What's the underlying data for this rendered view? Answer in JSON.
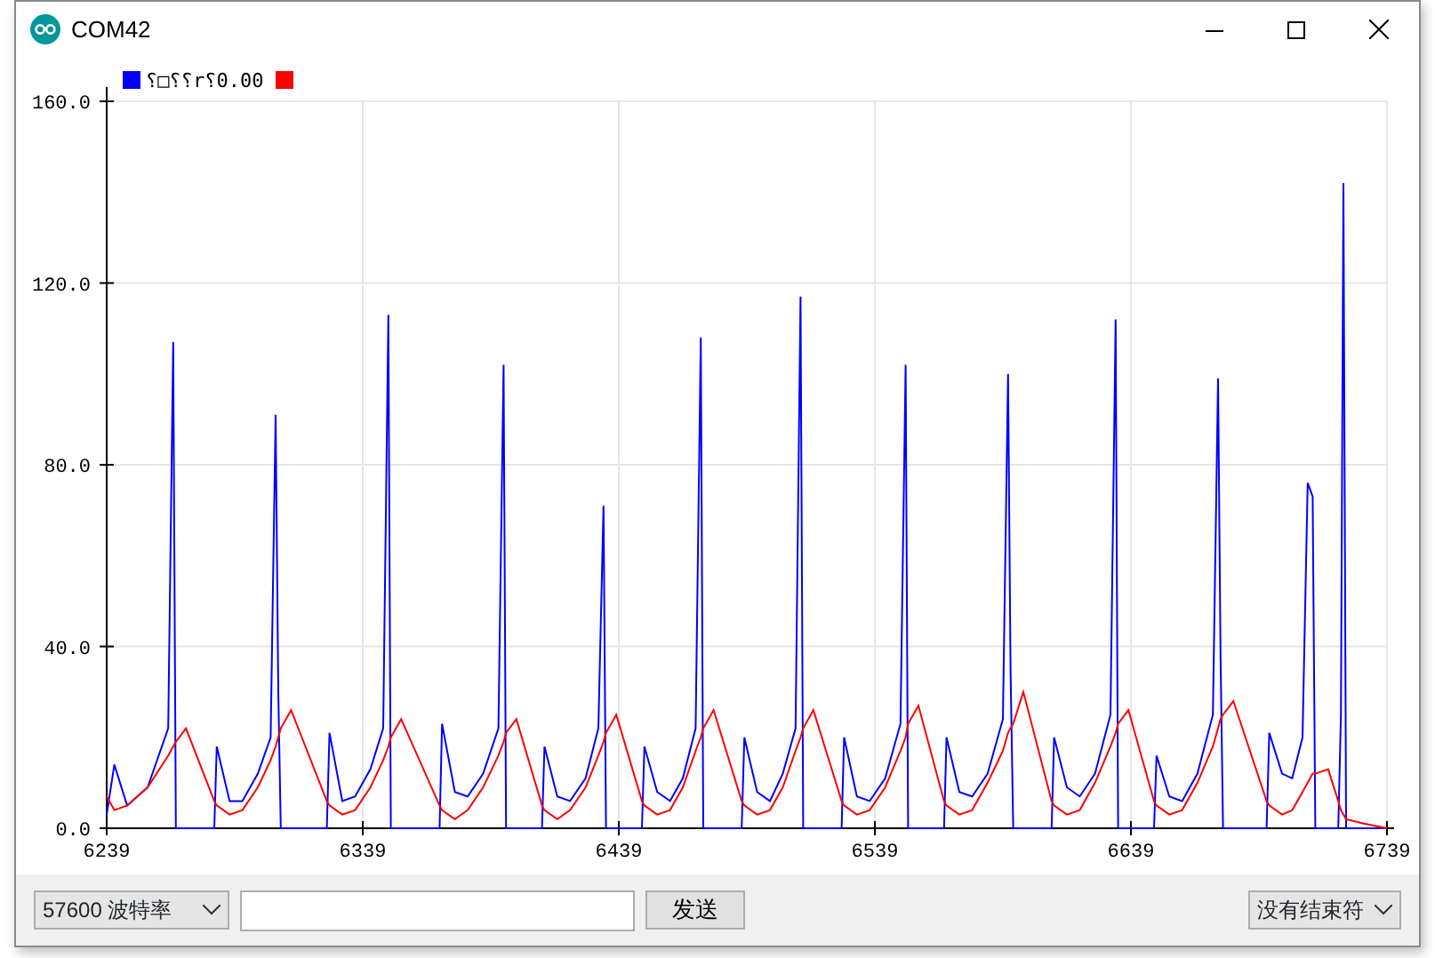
{
  "window": {
    "title": "COM42"
  },
  "plot": {
    "chart_data": {
      "type": "line",
      "x": [
        6239,
        6242,
        6247,
        6255,
        6263,
        6265,
        6266,
        6270,
        6281,
        6282,
        6287,
        6292,
        6298,
        6303,
        6305,
        6306,
        6307,
        6311,
        6325,
        6326,
        6331,
        6336,
        6342,
        6347,
        6349,
        6350,
        6354,
        6369,
        6370,
        6375,
        6380,
        6386,
        6392,
        6394,
        6395,
        6399,
        6409,
        6410,
        6415,
        6420,
        6426,
        6431,
        6433,
        6434,
        6438,
        6448,
        6449,
        6454,
        6459,
        6464,
        6469,
        6471,
        6472,
        6476,
        6487,
        6488,
        6493,
        6498,
        6503,
        6508,
        6510,
        6511,
        6515,
        6526,
        6527,
        6532,
        6537,
        6543,
        6549,
        6551,
        6552,
        6556,
        6566,
        6567,
        6572,
        6577,
        6583,
        6589,
        6591,
        6592,
        6593,
        6597,
        6608,
        6609,
        6614,
        6619,
        6625,
        6631,
        6633,
        6634,
        6638,
        6648,
        6649,
        6654,
        6659,
        6665,
        6671,
        6673,
        6674,
        6675,
        6679,
        6692,
        6693,
        6698,
        6702,
        6706,
        6708,
        6710,
        6711,
        6716,
        6720,
        6721,
        6722,
        6723,
        6730,
        6739
      ],
      "series": [
        {
          "name": "⸮□⸮⸮r⸮0.00",
          "color": "#0000ff",
          "values": [
            3,
            14,
            5,
            9,
            22,
            107,
            0,
            0,
            0,
            18,
            6,
            6,
            12,
            20,
            91,
            30,
            0,
            0,
            0,
            21,
            6,
            7,
            13,
            22,
            113,
            0,
            0,
            0,
            23,
            8,
            7,
            12,
            22,
            102,
            0,
            0,
            0,
            18,
            7,
            6,
            11,
            22,
            71,
            0,
            0,
            0,
            18,
            8,
            6,
            11,
            22,
            108,
            0,
            0,
            0,
            20,
            8,
            6,
            12,
            22,
            117,
            0,
            0,
            0,
            20,
            7,
            6,
            11,
            23,
            102,
            0,
            0,
            0,
            20,
            8,
            7,
            12,
            24,
            100,
            35,
            0,
            0,
            0,
            20,
            9,
            7,
            12,
            25,
            112,
            0,
            0,
            0,
            16,
            7,
            6,
            12,
            25,
            99,
            38,
            0,
            0,
            0,
            21,
            12,
            11,
            20,
            76,
            73,
            0,
            0,
            0,
            25,
            142,
            0,
            0,
            0
          ]
        },
        {
          "color": "#ff0000",
          "values": [
            7,
            4,
            5,
            9,
            16,
            18,
            19,
            22,
            6,
            5,
            3,
            4,
            9,
            15,
            18,
            20,
            22,
            26,
            6,
            5,
            3,
            4,
            9,
            15,
            18,
            20,
            24,
            5,
            4,
            2,
            4,
            9,
            16,
            19,
            21,
            24,
            5,
            4,
            2,
            4,
            9,
            16,
            19,
            21,
            25,
            6,
            5,
            3,
            4,
            9,
            17,
            20,
            22,
            26,
            6,
            5,
            3,
            4,
            9,
            17,
            20,
            22,
            26,
            6,
            5,
            3,
            4,
            9,
            17,
            20,
            23,
            27,
            6,
            5,
            3,
            4,
            10,
            17,
            21,
            22,
            23,
            30,
            6,
            5,
            3,
            4,
            10,
            18,
            21,
            23,
            26,
            6,
            5,
            3,
            4,
            10,
            18,
            22,
            24,
            25,
            28,
            6,
            5,
            3,
            4,
            8,
            10,
            12,
            12,
            13,
            6,
            4,
            3,
            2,
            1,
            0
          ]
        }
      ],
      "grid": true,
      "xlim": [
        6239,
        6739
      ],
      "ylim": [
        0,
        160
      ],
      "xticks": [
        6239,
        6339,
        6439,
        6539,
        6639,
        6739
      ],
      "yticks": [
        {
          "value": 0,
          "label": "0.0"
        },
        {
          "value": 40,
          "label": "40.0"
        },
        {
          "value": 80,
          "label": "80.0"
        },
        {
          "value": 120,
          "label": "120.0"
        },
        {
          "value": 160,
          "label": "160.0"
        }
      ]
    }
  },
  "controls": {
    "baud_rate": "57600 波特率",
    "send_button": "发送",
    "line_ending": "没有结束符"
  }
}
